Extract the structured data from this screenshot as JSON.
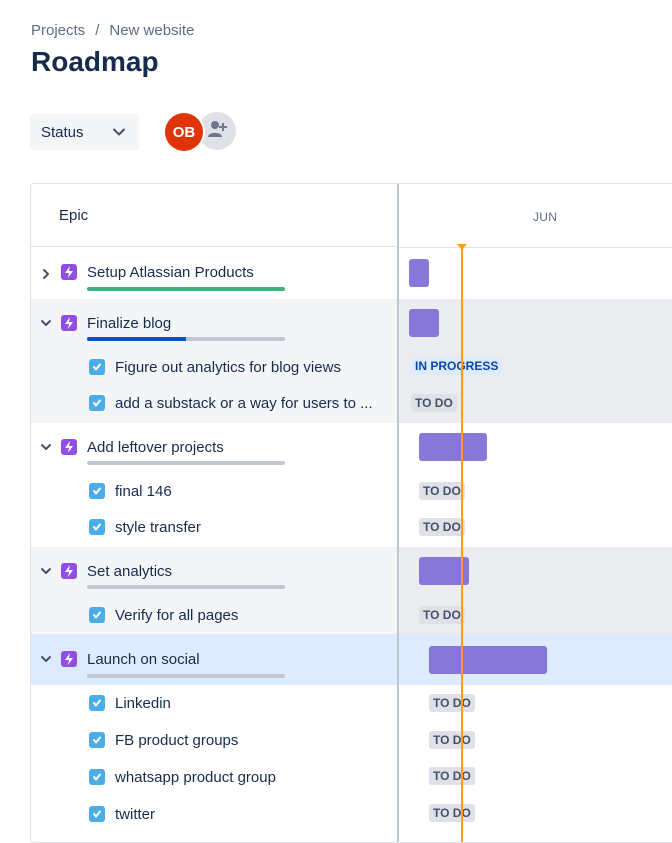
{
  "breadcrumb": {
    "projects": "Projects",
    "separator": "/",
    "project": "New website"
  },
  "page_title": "Roadmap",
  "filters": {
    "status_label": "Status"
  },
  "avatar": {
    "initials": "OB",
    "color": "#de350b"
  },
  "grid": {
    "epic_header": "Epic",
    "month": "JUN"
  },
  "colors": {
    "epic_icon": "#904ee2",
    "task_check": "#4bade8",
    "bar": "#8777d9",
    "today_line": "#ff991f",
    "selected_row": "#deebff",
    "alt_row": "#f4f5f7"
  },
  "epics": [
    {
      "label": "Setup Atlassian Products",
      "expanded": false,
      "progress_color": "#36b37e",
      "progress_done": 1.0
    },
    {
      "label": "Finalize blog",
      "expanded": true,
      "progress_color": "#0052cc",
      "progress_done": 0.5,
      "tasks": [
        {
          "label": "Figure out analytics for blog views",
          "status": "IN PROGRESS"
        },
        {
          "label": "add a substack or a way for users to ...",
          "status": "TO DO"
        }
      ]
    },
    {
      "label": "Add leftover projects",
      "expanded": true,
      "progress_color": "#0052cc",
      "progress_done": 0,
      "tasks": [
        {
          "label": "final 146",
          "status": "TO DO"
        },
        {
          "label": "style transfer",
          "status": "TO DO"
        }
      ]
    },
    {
      "label": "Set analytics",
      "expanded": true,
      "progress_color": "#0052cc",
      "progress_done": 0,
      "tasks": [
        {
          "label": "Verify for all pages",
          "status": "TO DO"
        }
      ]
    },
    {
      "label": "Launch on social",
      "expanded": true,
      "progress_color": "#0052cc",
      "progress_done": 0,
      "tasks": [
        {
          "label": "Linkedin",
          "status": "TO DO"
        },
        {
          "label": "FB product groups",
          "status": "TO DO"
        },
        {
          "label": "whatsapp product group",
          "status": "TO DO"
        },
        {
          "label": "twitter",
          "status": "TO DO"
        }
      ]
    }
  ]
}
